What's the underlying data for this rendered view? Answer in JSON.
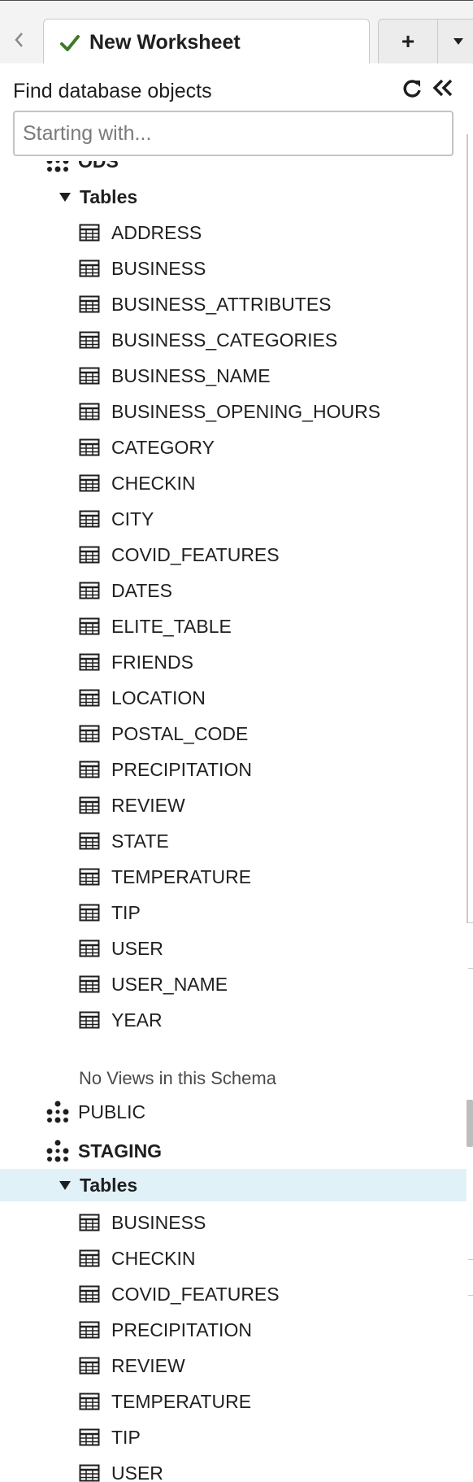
{
  "tabbar": {
    "worksheet_title": "New Worksheet",
    "add_label": "+",
    "check_color": "#3d7a28"
  },
  "finder": {
    "title": "Find database objects",
    "search_placeholder": "Starting with..."
  },
  "tree": {
    "ods": {
      "name": "ODS",
      "tables_label": "Tables",
      "tables": [
        "ADDRESS",
        "BUSINESS",
        "BUSINESS_ATTRIBUTES",
        "BUSINESS_CATEGORIES",
        "BUSINESS_NAME",
        "BUSINESS_OPENING_HOURS",
        "CATEGORY",
        "CHECKIN",
        "CITY",
        "COVID_FEATURES",
        "DATES",
        "ELITE_TABLE",
        "FRIENDS",
        "LOCATION",
        "POSTAL_CODE",
        "PRECIPITATION",
        "REVIEW",
        "STATE",
        "TEMPERATURE",
        "TIP",
        "USER",
        "USER_NAME",
        "YEAR"
      ],
      "views_note": "No Views in this Schema"
    },
    "public": {
      "name": "PUBLIC"
    },
    "staging": {
      "name": "STAGING",
      "tables_label": "Tables",
      "tables": [
        "BUSINESS",
        "CHECKIN",
        "COVID_FEATURES",
        "PRECIPITATION",
        "REVIEW",
        "TEMPERATURE",
        "TIP",
        "USER"
      ]
    }
  },
  "icons": {
    "back": "chevron-left-icon",
    "check": "checkmark-icon",
    "menu": "caret-down-icon",
    "refresh": "refresh-icon",
    "collapse": "double-chevron-left-icon",
    "schema": "schema-icon",
    "table": "table-icon",
    "caret": "caret-down-icon"
  },
  "colors": {
    "selected_row": "#e1f1f8"
  }
}
